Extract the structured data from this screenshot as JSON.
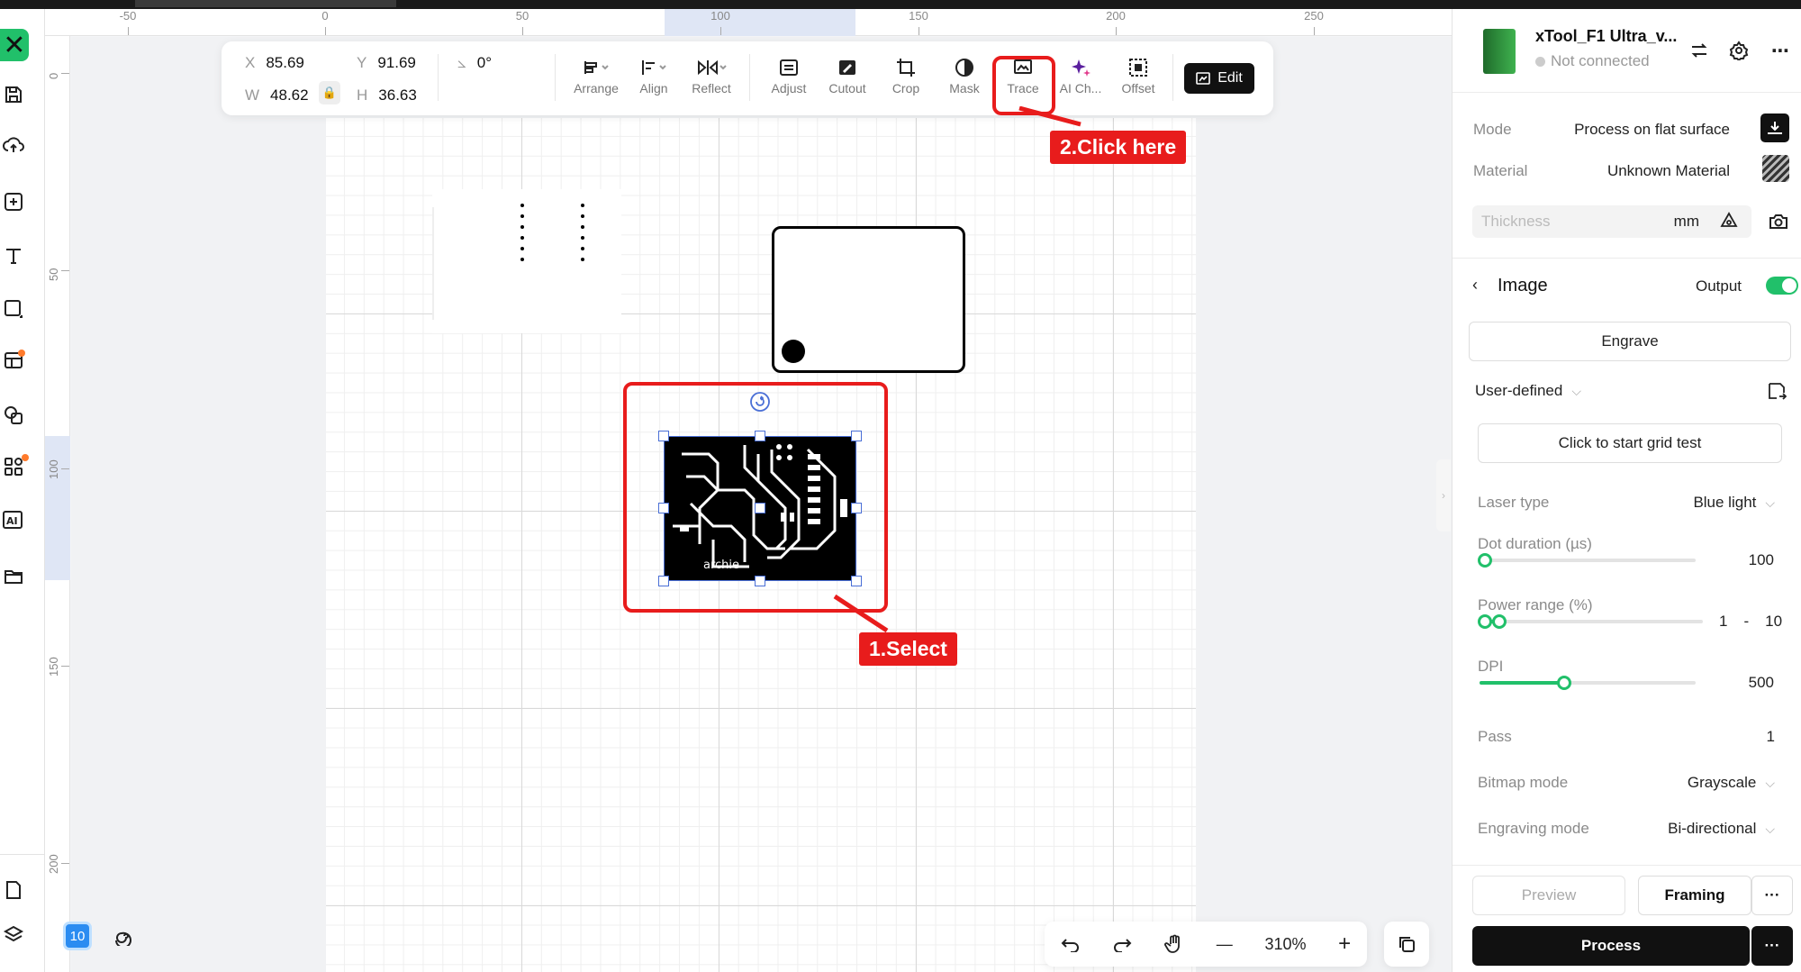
{
  "ruler": {
    "h_ticks": [
      "-50",
      "0",
      "50",
      "100",
      "150",
      "200",
      "250"
    ],
    "v_ticks": [
      "0",
      "50",
      "100",
      "150",
      "200"
    ]
  },
  "toolbar": {
    "x_label": "X",
    "x_value": "85.69",
    "y_label": "Y",
    "y_value": "91.69",
    "w_label": "W",
    "w_value": "48.62",
    "h_label": "H",
    "h_value": "36.63",
    "angle_value": "0°",
    "arrange": "Arrange",
    "align": "Align",
    "reflect": "Reflect",
    "adjust": "Adjust",
    "cutout": "Cutout",
    "crop": "Crop",
    "mask": "Mask",
    "trace": "Trace",
    "ai": "AI Ch...",
    "offset": "Offset",
    "edit": "Edit"
  },
  "canvas": {
    "pcb_text": "archie"
  },
  "annotations": {
    "step1": "1.Select",
    "step2": "2.Click here",
    "color": "#e81c1c"
  },
  "bottom": {
    "badge": "10",
    "zoom": "310%"
  },
  "device": {
    "name": "xTool_F1 Ultra_v...",
    "status": "Not connected"
  },
  "settings": {
    "mode_label": "Mode",
    "mode_value": "Process on flat surface",
    "material_label": "Material",
    "material_value": "Unknown Material",
    "thickness_placeholder": "Thickness",
    "thickness_unit": "mm",
    "section_title": "Image",
    "output_label": "Output",
    "engrave_button": "Engrave",
    "preset": "User-defined",
    "grid_test": "Click to start grid test",
    "laser_type_label": "Laser type",
    "laser_type_value": "Blue light",
    "dot_duration_label": "Dot duration (µs)",
    "dot_duration_value": "100",
    "power_label": "Power range (%)",
    "power_min": "1",
    "power_dash": "-",
    "power_max": "10",
    "dpi_label": "DPI",
    "dpi_value": "500",
    "pass_label": "Pass",
    "pass_value": "1",
    "bitmap_label": "Bitmap mode",
    "bitmap_value": "Grayscale",
    "engraving_label": "Engraving mode",
    "engraving_value": "Bi-directional"
  },
  "actions": {
    "preview": "Preview",
    "framing": "Framing",
    "process": "Process",
    "more": "···"
  },
  "colors": {
    "accent": "#21c06a",
    "selection": "#4a6fd6"
  }
}
